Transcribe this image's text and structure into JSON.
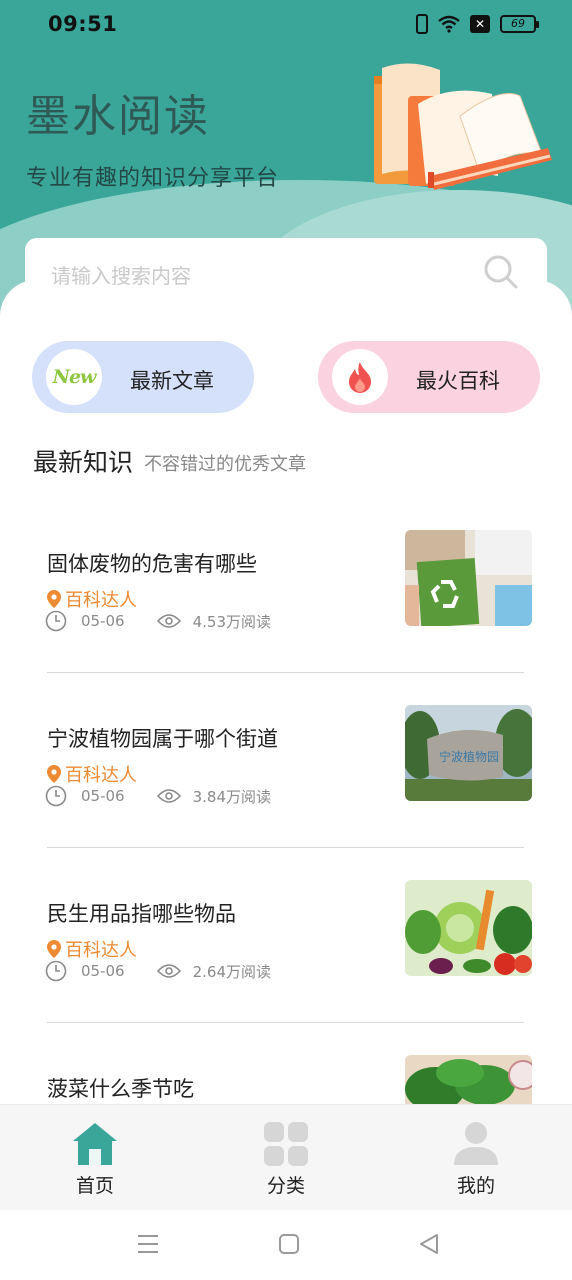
{
  "status_bar": {
    "time": "09:51",
    "battery": "69"
  },
  "header": {
    "title": "墨水阅读",
    "subtitle": "专业有趣的知识分享平台"
  },
  "search": {
    "placeholder": "请输入搜索内容"
  },
  "shortcuts": [
    {
      "icon": "new-badge-icon",
      "icon_text": "New",
      "label": "最新文章",
      "color": "#d5e0fb"
    },
    {
      "icon": "fire-icon",
      "label": "最火百科",
      "color": "#fbd3e0"
    }
  ],
  "section": {
    "title": "最新知识",
    "subtitle": "不容错过的优秀文章"
  },
  "articles": [
    {
      "title": "固体废物的危害有哪些",
      "author": "百科达人",
      "date": "05-06",
      "views": "4.53万阅读",
      "thumb": "recycling-image"
    },
    {
      "title": "宁波植物园属于哪个街道",
      "author": "百科达人",
      "date": "05-06",
      "views": "3.84万阅读",
      "thumb": "botanical-garden-image"
    },
    {
      "title": "民生用品指哪些物品",
      "author": "百科达人",
      "date": "05-06",
      "views": "2.64万阅读",
      "thumb": "vegetables-image"
    },
    {
      "title": "菠菜什么季节吃",
      "thumb": "spinach-image"
    }
  ],
  "tabs": [
    {
      "label": "首页",
      "icon": "home-icon",
      "active": true
    },
    {
      "label": "分类",
      "icon": "grid-icon",
      "active": false
    },
    {
      "label": "我的",
      "icon": "user-icon",
      "active": false
    }
  ],
  "colors": {
    "accent": "#3aa69a",
    "author": "#ee8a33"
  }
}
